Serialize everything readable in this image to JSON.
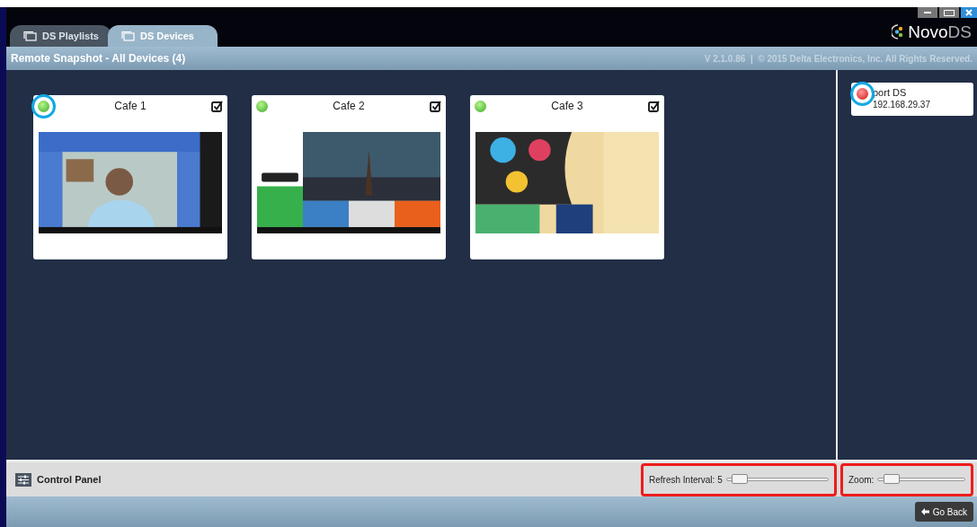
{
  "tabs": [
    {
      "label": "DS Playlists",
      "selected": false
    },
    {
      "label": "DS Devices",
      "selected": true
    }
  ],
  "brand": {
    "first": "Novo",
    "second": "DS"
  },
  "title_bar": {
    "title": "Remote Snapshot - All Devices (4)",
    "version": "V 2.1.0.86  |  © 2015 Delta Electronics, Inc. All Rights Reserved."
  },
  "devices": [
    {
      "name": "Cafe 1",
      "online": true,
      "checked": true,
      "highlighted": true
    },
    {
      "name": "Cafe 2",
      "online": true,
      "checked": true,
      "highlighted": false
    },
    {
      "name": "Cafe 3",
      "online": true,
      "checked": true,
      "highlighted": false
    }
  ],
  "side_devices": [
    {
      "name": "port DS",
      "address": "192.168.29.37",
      "online": false,
      "highlighted": true
    }
  ],
  "control_panel": {
    "label": "Control Panel",
    "sliders": [
      {
        "label": "Refresh Interval: 5",
        "level": 0.08,
        "highlighted": true
      },
      {
        "label": "Zoom:",
        "level": 0.1,
        "highlighted": true
      }
    ]
  },
  "footer": {
    "button": "Go Back"
  }
}
